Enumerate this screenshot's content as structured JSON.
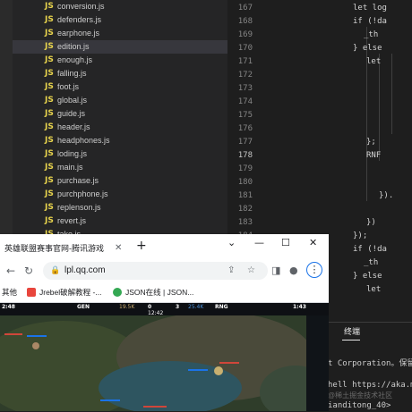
{
  "file_tree": {
    "files": [
      {
        "name": "conversion.js",
        "icon": "js-icon"
      },
      {
        "name": "defenders.js",
        "icon": "js-icon"
      },
      {
        "name": "earphone.js",
        "icon": "js-icon"
      },
      {
        "name": "edition.js",
        "icon": "js-icon",
        "selected": true
      },
      {
        "name": "enough.js",
        "icon": "js-icon"
      },
      {
        "name": "falling.js",
        "icon": "js-icon"
      },
      {
        "name": "foot.js",
        "icon": "js-icon"
      },
      {
        "name": "global.js",
        "icon": "js-icon"
      },
      {
        "name": "guide.js",
        "icon": "js-icon"
      },
      {
        "name": "header.js",
        "icon": "js-icon"
      },
      {
        "name": "headphones.js",
        "icon": "js-icon"
      },
      {
        "name": "loding.js",
        "icon": "js-icon"
      },
      {
        "name": "main.js",
        "icon": "js-icon"
      },
      {
        "name": "purchase.js",
        "icon": "js-icon"
      },
      {
        "name": "purchphone.js",
        "icon": "js-icon"
      },
      {
        "name": "replenson.js",
        "icon": "js-icon"
      },
      {
        "name": "revert.js",
        "icon": "js-icon"
      },
      {
        "name": "take.js",
        "icon": "js-icon"
      }
    ],
    "js_badge": "JS"
  },
  "editor": {
    "current_line": "178",
    "lines": [
      {
        "num": "167",
        "code": "let log"
      },
      {
        "num": "168",
        "code": "if (!da"
      },
      {
        "num": "169",
        "code": "_th"
      },
      {
        "num": "170",
        "code": "} else"
      },
      {
        "num": "171",
        "code": "let"
      },
      {
        "num": "172",
        "code": ""
      },
      {
        "num": "173",
        "code": ""
      },
      {
        "num": "174",
        "code": ""
      },
      {
        "num": "175",
        "code": ""
      },
      {
        "num": "176",
        "code": ""
      },
      {
        "num": "177",
        "code": "};"
      },
      {
        "num": "178",
        "code": "RNF"
      },
      {
        "num": "179",
        "code": ""
      },
      {
        "num": "180",
        "code": ""
      },
      {
        "num": "181",
        "code": "})."
      },
      {
        "num": "182",
        "code": ""
      },
      {
        "num": "183",
        "code": "})"
      },
      {
        "num": "184",
        "code": "});"
      },
      {
        "num": "185",
        "code": "if (!da"
      },
      {
        "num": "186",
        "code": "_th"
      },
      {
        "num": "187",
        "code": "} else"
      },
      {
        "num": "188",
        "code": "let"
      }
    ]
  },
  "terminal": {
    "tab_label": "终端",
    "lines": [
      "t Corporation。保留所",
      "hell https://aka.ms/",
      "ianditong_40>"
    ],
    "watermark": "@稀土掘金技术社区"
  },
  "browser": {
    "tab_title": "英雄联盟赛事官网-腾讯游戏",
    "url": "lpl.qq.com",
    "bookmarks": [
      {
        "label": "其他"
      },
      {
        "label": "Jrebel破解教程 -...",
        "color": "#e8453c"
      },
      {
        "label": "JSON在线 | JSON...",
        "color": "#34a853"
      }
    ],
    "game": {
      "team_left": "GEN",
      "team_right": "RNG",
      "gold_left": "19.5K",
      "gold_right": "25.4K",
      "kills_left": "0",
      "kills_right": "3",
      "game_time": "12:42",
      "time_left": "2:48",
      "time_right": "1:43",
      "accent_left": "#c8aa6e",
      "accent_right": "#4a90d9"
    }
  }
}
